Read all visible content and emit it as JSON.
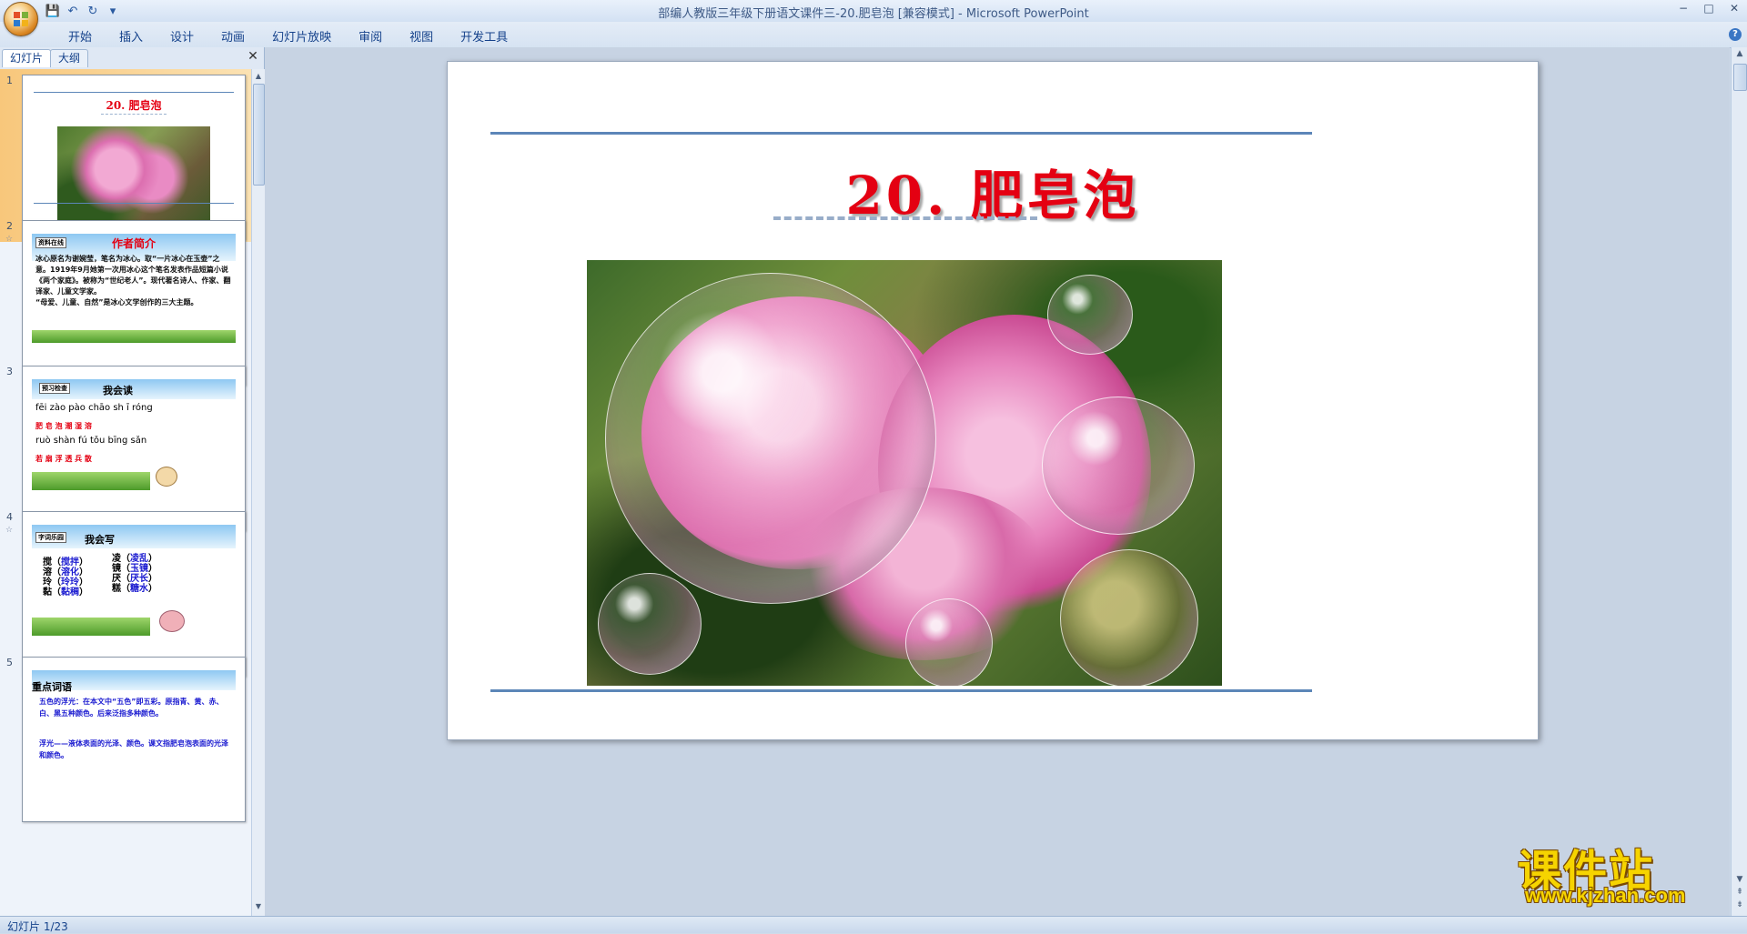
{
  "window": {
    "title": "部编人教版三年级下册语文课件三-20.肥皂泡 [兼容模式] - Microsoft PowerPoint",
    "min": "−",
    "max": "□",
    "close": "✕"
  },
  "qat": {
    "save": "💾",
    "undo": "↶",
    "redo": "↻",
    "more": "▾"
  },
  "ribbon": {
    "tabs": [
      "开始",
      "插入",
      "设计",
      "动画",
      "幻灯片放映",
      "审阅",
      "视图",
      "开发工具"
    ],
    "help": "?"
  },
  "left_pane": {
    "tabs": [
      "幻灯片",
      "大纲"
    ],
    "close": "✕",
    "slides": [
      {
        "num": "1",
        "title": "20. 肥皂泡"
      },
      {
        "num": "2",
        "tag": "资料在线",
        "head": "作者简介",
        "body": "冰心原名为谢婉莹，笔名为冰心。取“一片冰心在玉壶”之意。1919年9月她第一次用冰心这个笔名发表作品短篇小说《两个家庭》。被称为“世纪老人”。现代著名诗人、作家、翻译家、儿童文学家。",
        "body2": "“母爱、儿童、自然”是冰心文学创作的三大主题。"
      },
      {
        "num": "3",
        "tag": "预习检查",
        "head": "我会读",
        "lines": [
          "fēi zào pào chāo sh ī róng",
          "肥   皂   泡   潮   湿   溶",
          "ruò  shàn fú tǒu bīng sǎn",
          "若   扇   浮   透   兵   散"
        ]
      },
      {
        "num": "4",
        "tag": "字词乐园",
        "head": "我会写",
        "left": [
          [
            "搅",
            "搅拌"
          ],
          [
            "溶",
            "溶化"
          ],
          [
            "玲",
            "玲玲"
          ],
          [
            "黏",
            "黏稠"
          ]
        ],
        "right": [
          [
            "凌",
            "凌乱"
          ],
          [
            "镜",
            "玉镜"
          ],
          [
            "厌",
            "厌长"
          ],
          [
            "糕",
            "糖水"
          ]
        ]
      },
      {
        "num": "5",
        "head": "重点词语",
        "body": "五色的浮光：在本文中“五色”即五彩。原指青、黄、赤、白、黑五种颜色。后来泛指多种颜色。",
        "body2": "浮光——液体表面的光泽、颜色。课文指肥皂泡表面的光泽和颜色。"
      }
    ]
  },
  "slide": {
    "title": "20. 肥皂泡"
  },
  "status": {
    "text": "幻灯片 1/23"
  },
  "watermark": {
    "cn": "课件站",
    "url": "www.kjzhan.com"
  },
  "colors": {
    "title_red": "#e40012",
    "rule_blue": "#5c86b8",
    "ribbon_text": "#15428b"
  }
}
